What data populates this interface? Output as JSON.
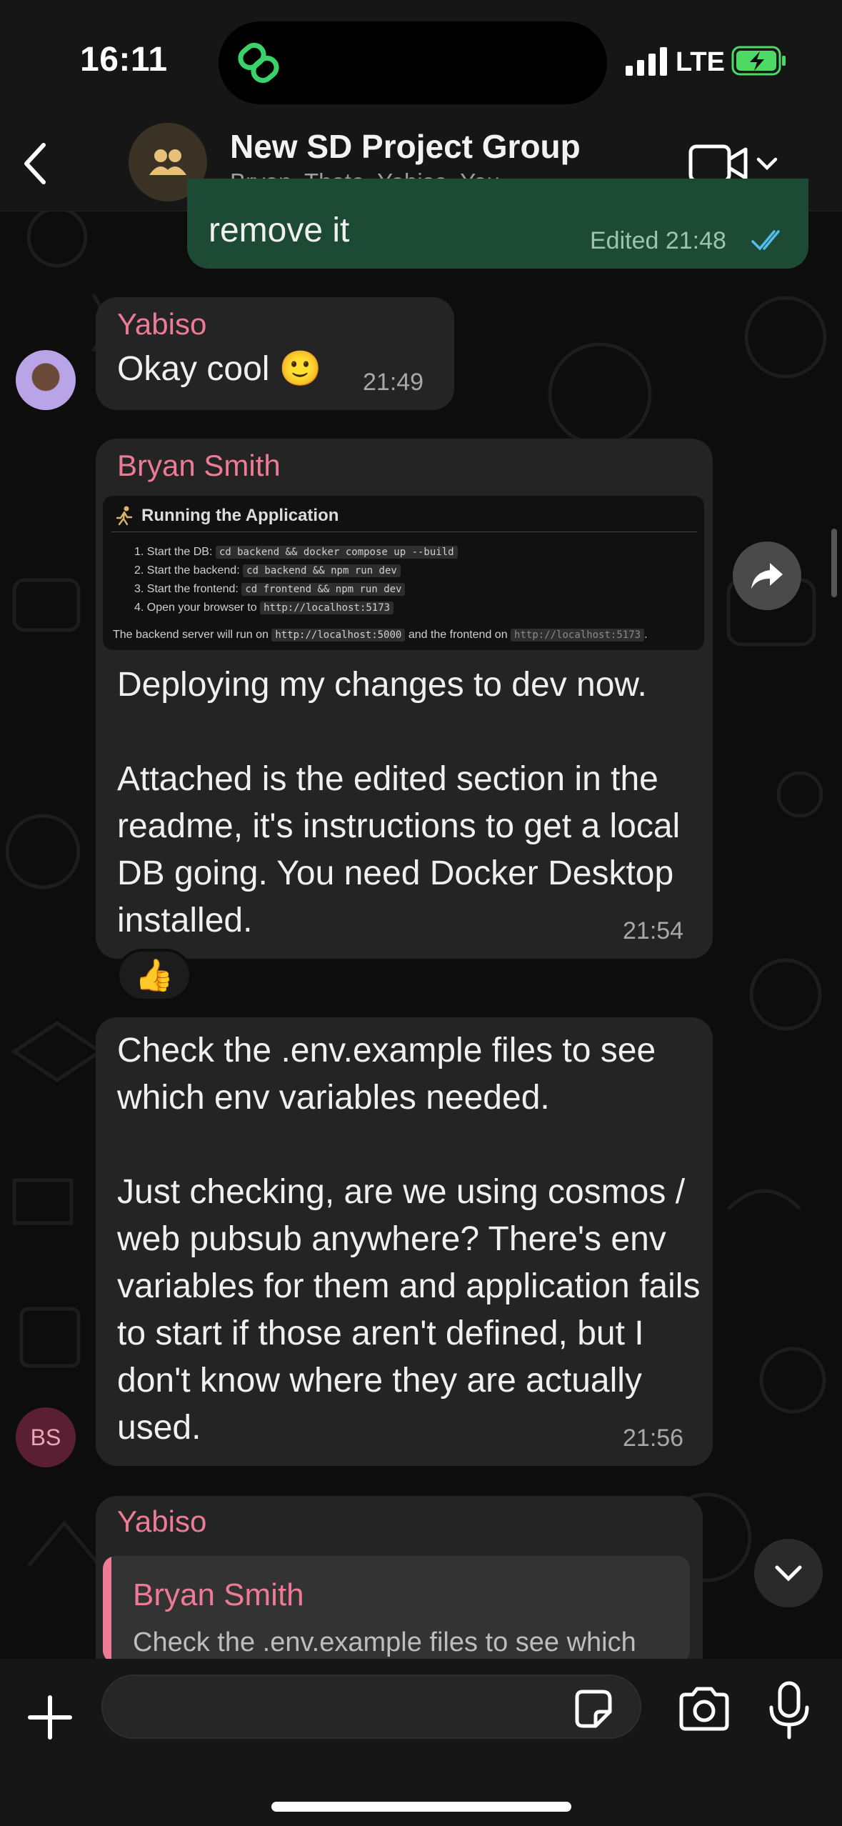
{
  "status_bar": {
    "time": "16:11",
    "network": "LTE",
    "icons": [
      "link-activity-icon",
      "signal-icon",
      "battery-charging-icon"
    ]
  },
  "header": {
    "title": "New SD Project Group",
    "members": "Bryan, Thato, Yabiso, You",
    "icons": [
      "back-chevron-icon",
      "group-icon",
      "video-call-icon",
      "chevron-down-icon"
    ]
  },
  "messages": {
    "m0": {
      "text": "remove it",
      "time": "Edited 21:48",
      "status_icon": "double-check-icon"
    },
    "m1": {
      "sender": "Yabiso",
      "text": "Okay cool 🙂",
      "time": "21:49"
    },
    "m2": {
      "sender": "Bryan Smith",
      "attachment": {
        "title": "Running the Application",
        "steps": [
          {
            "label": "1. Start the DB:",
            "code": "cd backend && docker compose up --build"
          },
          {
            "label": "2. Start the backend:",
            "code": "cd backend && npm run dev"
          },
          {
            "label": "3. Start the frontend:",
            "code": "cd frontend && npm run dev"
          },
          {
            "label": "4. Open your browser to",
            "code": "http://localhost:5173"
          }
        ],
        "note_prefix": "The backend server will run on",
        "note_code1": "http://localhost:5000",
        "note_mid": "and the frontend on",
        "note_code2": "http://localhost:5173",
        "note_suffix": "."
      },
      "text": "Deploying my changes to dev now.\n\nAttached is the edited section in the readme, it's instructions to get a local DB going. You need Docker Desktop installed.",
      "time": "21:54",
      "reaction": "👍"
    },
    "m3": {
      "avatar_initials": "BS",
      "text": "Check the .env.example files to see which env variables needed.\n\nJust checking, are we using cosmos / web pubsub anywhere? There's env variables for them and application fails to start if those aren't defined, but I don't know where they are actually used.",
      "time": "21:56"
    },
    "m4": {
      "sender": "Yabiso",
      "quote_sender": "Bryan Smith",
      "quote_text": "Check the .env.example files to see which"
    }
  },
  "composer": {
    "placeholder": "",
    "icons": [
      "plus-icon",
      "sticker-icon",
      "camera-icon",
      "microphone-icon"
    ]
  },
  "colors": {
    "sender_pink": "#ee7b96",
    "outgoing_bubble": "#1c4a34",
    "incoming_bubble": "#242424",
    "read_check": "#53bdeb"
  }
}
